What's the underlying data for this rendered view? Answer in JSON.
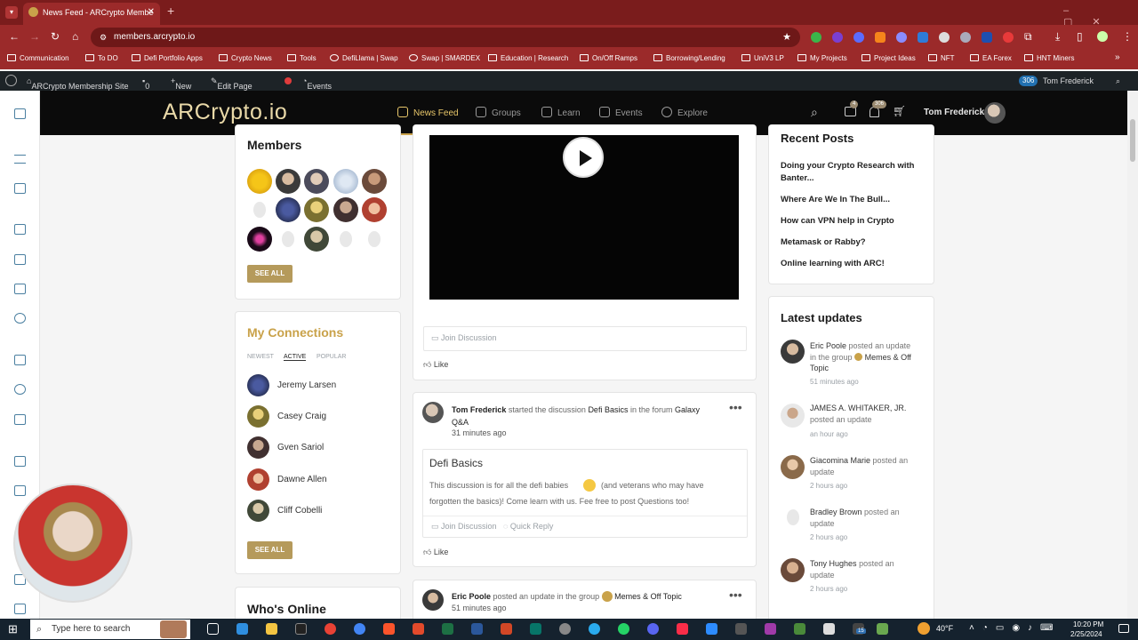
{
  "browser": {
    "tab_title": "News Feed - ARCrypto Membe",
    "url": "members.arcrypto.io",
    "bookmarks": [
      "Communication",
      "To DO",
      "Defi Portfolio Apps",
      "Crypto News",
      "Tools",
      "DefiLlama | Swap",
      "Swap | SMARDEX",
      "Education | Research",
      "On/Off Ramps",
      "Borrowing/Lending",
      "UniV3 LP",
      "My Projects",
      "Project Ideas",
      "NFT",
      "EA Forex",
      "HNT Miners"
    ]
  },
  "wpbar": {
    "site": "ARCrypto Membership Site",
    "comments": "0",
    "new": "New",
    "edit": "Edit Page",
    "events": "Events",
    "notif": "306",
    "user": "Tom Frederick"
  },
  "header": {
    "logo": "ARCrypto.io",
    "nav": [
      "News Feed",
      "Groups",
      "Learn",
      "Events",
      "Explore"
    ],
    "badge_msgs": "4",
    "badge_notif": "306",
    "user": "Tom Frederick"
  },
  "members": {
    "title": "Members",
    "see_all": "SEE ALL"
  },
  "connections": {
    "title": "My Connections",
    "tabs": [
      "NEWEST",
      "ACTIVE",
      "POPULAR"
    ],
    "people": [
      "Jeremy Larsen",
      "Casey Craig",
      "Gven Sariol",
      "Dawne Allen",
      "Cliff Cobelli"
    ],
    "see_all": "SEE ALL"
  },
  "whos_online": {
    "title": "Who's Online"
  },
  "feed": {
    "video_join": "Join Discussion",
    "like": "Like",
    "post2": {
      "author": "Tom Frederick",
      "action": "started the discussion",
      "topic": "Defi Basics",
      "mid": "in the forum",
      "forum": "Galaxy Q&A",
      "time": "31 minutes ago",
      "title": "Defi Basics",
      "body1": "This discussion is for all the defi babies",
      "body2": "(and veterans who may have",
      "body3": "forgotten the basics)! Come learn with us. Fee free to post Questions too!",
      "join": "Join Discussion",
      "reply": "Quick Reply",
      "like": "Like"
    },
    "post3": {
      "author": "Eric Poole",
      "action": "posted an update in the group",
      "group": "Memes & Off Topic",
      "time": "51 minutes ago"
    }
  },
  "recent_posts": {
    "title": "Recent Posts",
    "items": [
      "Doing your Crypto Research with",
      "Banter...",
      "Where Are We In The Bull...",
      "How can VPN help in Crypto",
      "Metamask or Rabby?",
      "Online learning with ARC!"
    ]
  },
  "latest_updates": {
    "title": "Latest updates",
    "items": [
      {
        "name": "Eric Poole",
        "action": "posted an update",
        "l2": "in the group",
        "group": "Memes & Off",
        "l3": "Topic",
        "time": "51 minutes ago"
      },
      {
        "name": "JAMES A. WHITAKER, JR.",
        "action": "posted an update",
        "time": "an hour ago"
      },
      {
        "name": "Giacomina Marie",
        "action": "posted an",
        "l2": "update",
        "time": "2 hours ago"
      },
      {
        "name": "Bradley Brown",
        "action": "posted an",
        "l2": "update",
        "time": "2 hours ago"
      },
      {
        "name": "Tony Hughes",
        "action": "posted an",
        "l2": "update",
        "time": "2 hours ago"
      }
    ]
  },
  "taskbar": {
    "search": "Type here to search",
    "temp": "40°F",
    "time": "10:20 PM",
    "date": "2/25/2024",
    "badge": "15"
  }
}
